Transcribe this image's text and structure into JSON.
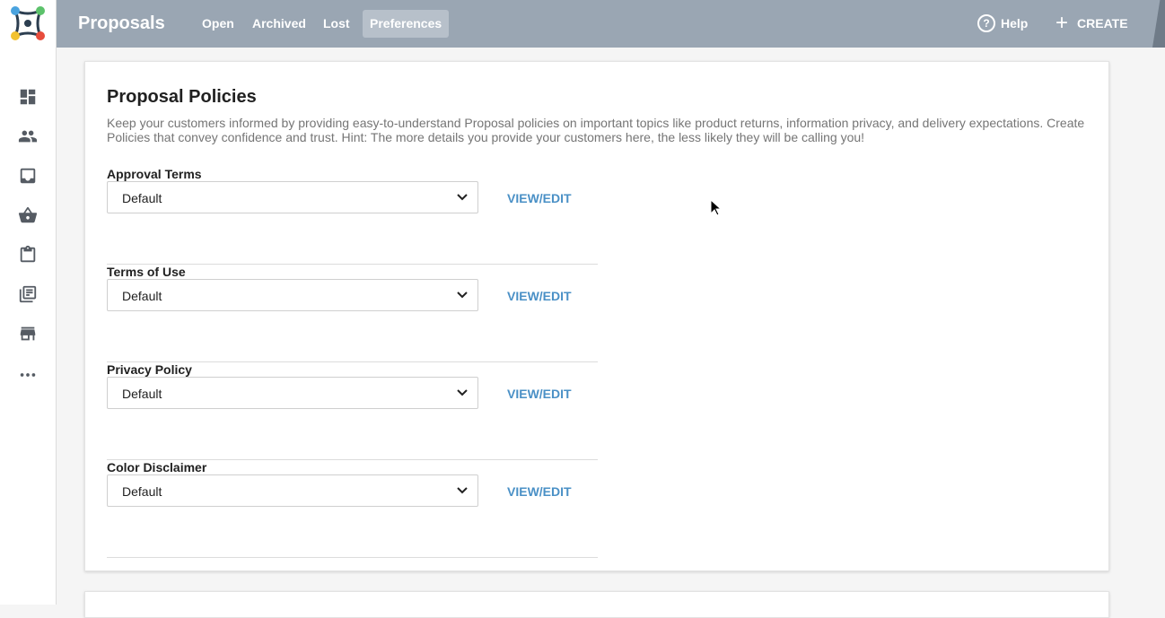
{
  "app": {
    "title": "Proposals"
  },
  "tabs": [
    {
      "label": "Open"
    },
    {
      "label": "Archived"
    },
    {
      "label": "Lost"
    },
    {
      "label": "Preferences"
    }
  ],
  "header": {
    "help_label": "Help",
    "help_glyph": "?",
    "create_label": "CREATE",
    "create_glyph": "+"
  },
  "sidebar": {
    "icons": [
      "dashboard-icon",
      "people-icon",
      "inbox-icon",
      "basket-icon",
      "clipboard-icon",
      "library-books-icon",
      "store-icon",
      "more-icon"
    ]
  },
  "section": {
    "title": "Proposal Policies",
    "description": "Keep your customers informed by providing easy-to-understand Proposal policies on important topics like product returns, information privacy, and delivery expectations. Create Policies that convey confidence and trust. Hint: The more details you provide your customers here, the less likely they will be calling you!"
  },
  "policies": [
    {
      "label": "Approval Terms",
      "value": "Default",
      "action": "VIEW/EDIT"
    },
    {
      "label": "Terms of Use",
      "value": "Default",
      "action": "VIEW/EDIT"
    },
    {
      "label": "Privacy Policy",
      "value": "Default",
      "action": "VIEW/EDIT"
    },
    {
      "label": "Color Disclaimer",
      "value": "Default",
      "action": "VIEW/EDIT"
    }
  ],
  "colors": {
    "topbar": "#9aa6b3",
    "active_tab": "#b7c0ca",
    "link": "#4a90c6",
    "sidebar_icon": "#555b63"
  }
}
